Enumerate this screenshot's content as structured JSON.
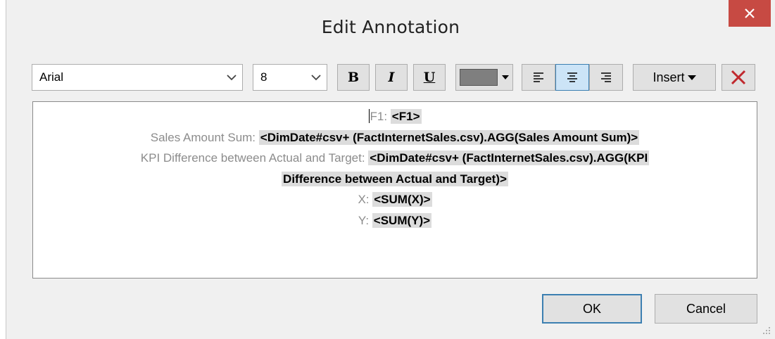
{
  "window": {
    "title": "Edit Annotation",
    "close_icon": "close-icon"
  },
  "toolbar": {
    "font_family": "Arial",
    "font_size": "8",
    "bold_label": "B",
    "italic_label": "I",
    "underline_label": "U",
    "text_color": "#7f7f7f",
    "align_left_icon": "align-left-icon",
    "align_center_icon": "align-center-icon",
    "align_right_icon": "align-right-icon",
    "align_selected": "center",
    "insert_label": "Insert",
    "clear_icon": "red-x-icon"
  },
  "editor": {
    "lines": [
      {
        "label": "F1: ",
        "value": "<F1>"
      },
      {
        "label": "Sales Amount Sum: ",
        "value": "<DimDate#csv+ (FactInternetSales.csv).AGG(Sales Amount Sum)>"
      },
      {
        "label": "KPI Difference between Actual and Target: ",
        "value": "<DimDate#csv+ (FactInternetSales.csv).AGG(KPI"
      },
      {
        "label": "",
        "value": "Difference between Actual and Target)>"
      },
      {
        "label": "X: ",
        "value": "<SUM(X)>"
      },
      {
        "label": "Y: ",
        "value": "<SUM(Y)>"
      }
    ]
  },
  "footer": {
    "ok_label": "OK",
    "cancel_label": "Cancel"
  },
  "colors": {
    "close_button": "#c74a43",
    "active_align_bg": "#cce4f7",
    "field_highlight": "#dcdcdc",
    "label_gray": "#8c8c8c"
  }
}
